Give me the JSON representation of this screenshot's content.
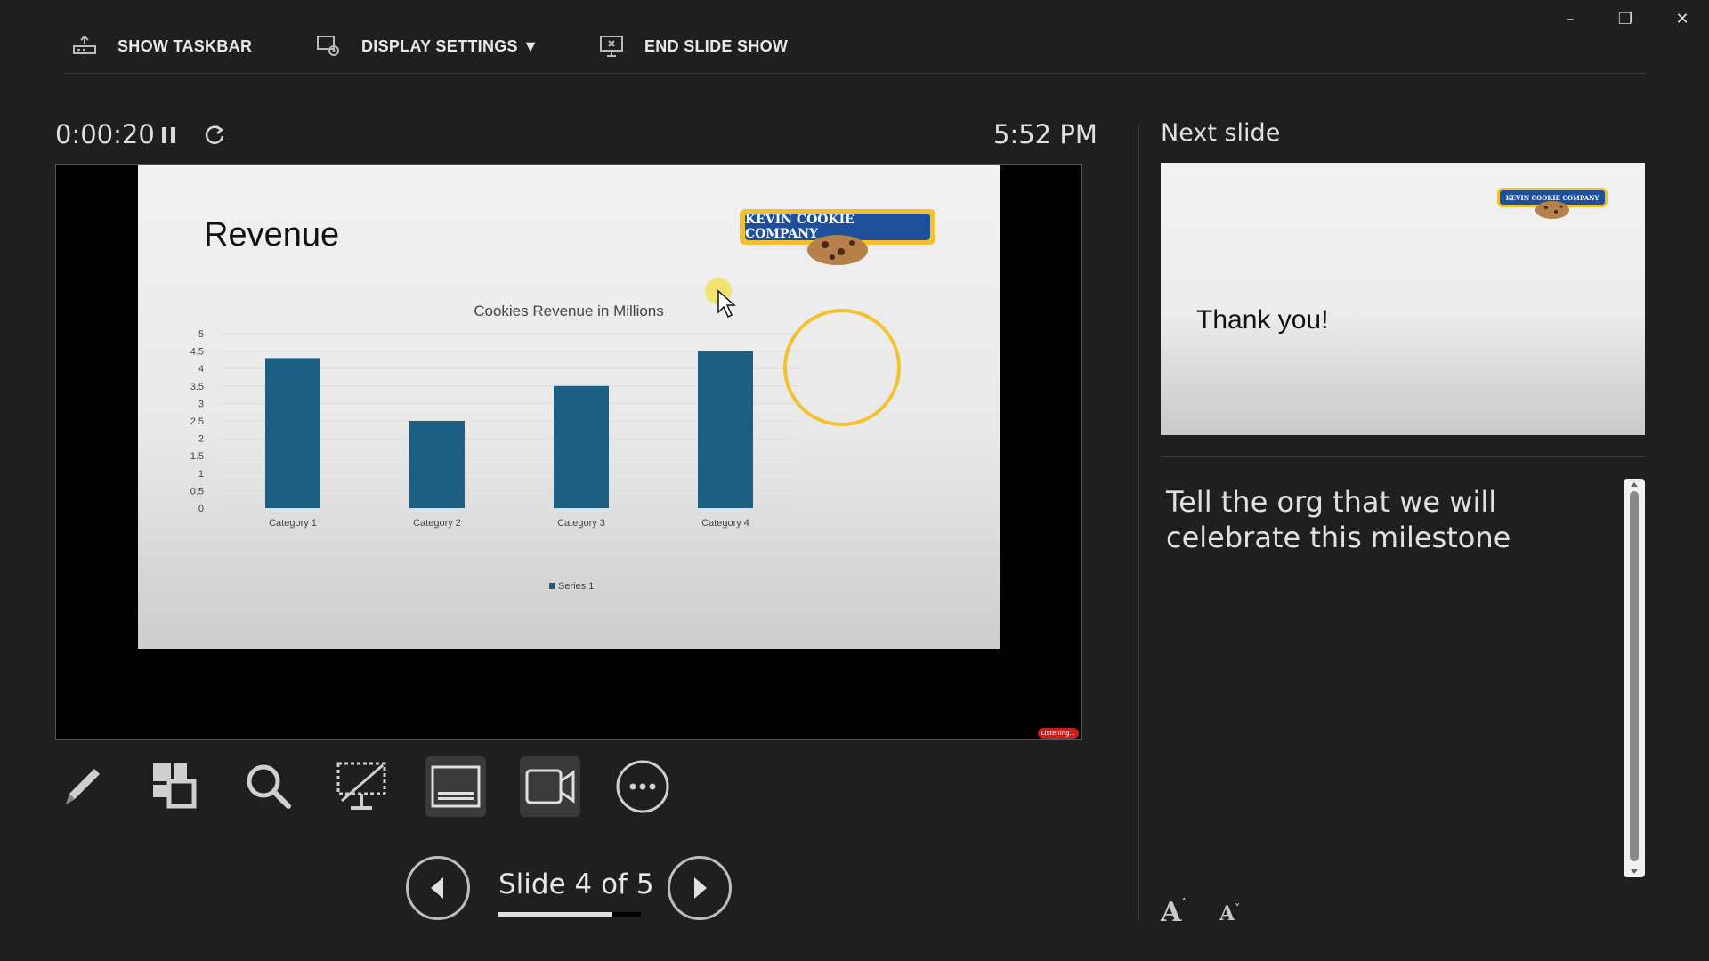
{
  "window": {
    "minimize": "–",
    "restore": "❐",
    "close": "✕"
  },
  "toolbar": {
    "show_taskbar": "SHOW TASKBAR",
    "display_settings": "DISPLAY SETTINGS ▼",
    "end_slide_show": "END SLIDE SHOW"
  },
  "timer": {
    "elapsed": "0:00:20",
    "clock": "5:52 PM"
  },
  "current_slide": {
    "title": "Revenue",
    "logo_text": "KEVIN COOKIE COMPANY",
    "listening": "Listening..."
  },
  "chart_data": {
    "type": "bar",
    "title": "Cookies Revenue in Millions",
    "categories": [
      "Category 1",
      "Category 2",
      "Category 3",
      "Category 4"
    ],
    "series": [
      {
        "name": "Series 1",
        "values": [
          4.3,
          2.5,
          3.5,
          4.5
        ]
      }
    ],
    "ylim": [
      0,
      5
    ],
    "yticks": [
      "0",
      "0.5",
      "1",
      "1.5",
      "2",
      "2.5",
      "3",
      "3.5",
      "4",
      "4.5",
      "5"
    ],
    "grid": true,
    "legend": "bottom",
    "bar_color": "#1c5f82",
    "highlight_color": "#f2c230"
  },
  "nav": {
    "counter": "Slide 4 of 5",
    "progress": 0.8
  },
  "next": {
    "label": "Next slide",
    "text": "Thank you!",
    "logo_text": "KEVIN COOKIE COMPANY"
  },
  "notes": {
    "text": "Tell the org that we will celebrate this milestone"
  },
  "font_controls": {
    "increase": "A",
    "decrease": "A"
  }
}
